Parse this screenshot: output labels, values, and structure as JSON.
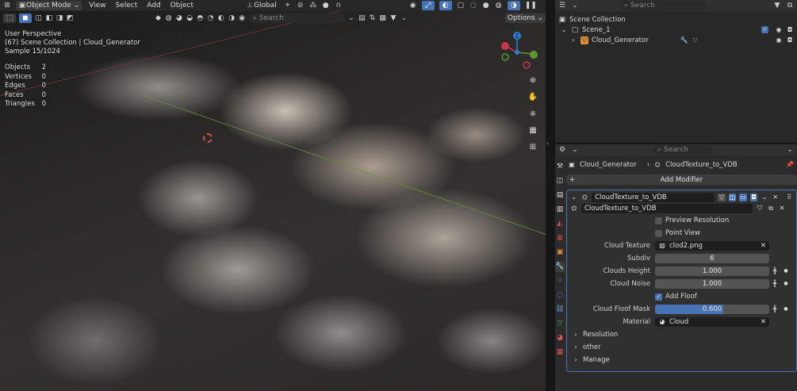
{
  "viewport": {
    "header": {
      "mode": "Object Mode",
      "menus": [
        "View",
        "Select",
        "Add",
        "Object"
      ],
      "orientation": "Global",
      "search_placeholder": "Search",
      "options": "Options"
    },
    "overlay": {
      "perspective": "User Perspective",
      "collection": "(67) Scene Collection | Cloud_Generator",
      "sample": "Sample 15/1024"
    },
    "stats": [
      {
        "label": "Objects",
        "value": "2"
      },
      {
        "label": "Vertices",
        "value": "0"
      },
      {
        "label": "Edges",
        "value": "0"
      },
      {
        "label": "Faces",
        "value": "0"
      },
      {
        "label": "Triangles",
        "value": "0"
      }
    ],
    "gizmo": {
      "z": "Z",
      "y": "Y",
      "x": "X"
    }
  },
  "outliner": {
    "search_placeholder": "Search",
    "root": "Scene Collection",
    "scene": "Scene_1",
    "object": "Cloud_Generator"
  },
  "properties": {
    "search_placeholder": "Search",
    "breadcrumb": {
      "object": "Cloud_Generator",
      "modifier": "CloudTexture_to_VDB"
    },
    "add_modifier": "Add Modifier",
    "modifier": {
      "name": "CloudTexture_to_VDB",
      "node_group": "CloudTexture_to_VDB",
      "preview_resolution": "Preview Resolution",
      "point_view": "Point View",
      "cloud_texture_label": "Cloud Texture",
      "cloud_texture_value": "clod2.png",
      "subdiv_label": "Subdiv",
      "subdiv_value": "6",
      "clouds_height_label": "Clouds Height",
      "clouds_height_value": "1.000",
      "cloud_noise_label": "Cloud Noise",
      "cloud_noise_value": "1.000",
      "add_floof_label": "Add Floof",
      "add_floof_checked": true,
      "floof_mask_label": "Cloud Floof Mask",
      "floof_mask_value": "0.600",
      "floof_mask_fraction": 0.6,
      "material_label": "Material",
      "material_value": "Cloud",
      "subpanels": [
        "Resolution",
        "other",
        "Manage"
      ]
    }
  },
  "colors": {
    "accent": "#4772b3",
    "gizmo_x": "#c4394a",
    "gizmo_y": "#5d9a2c",
    "gizmo_z": "#2f7fd6"
  }
}
